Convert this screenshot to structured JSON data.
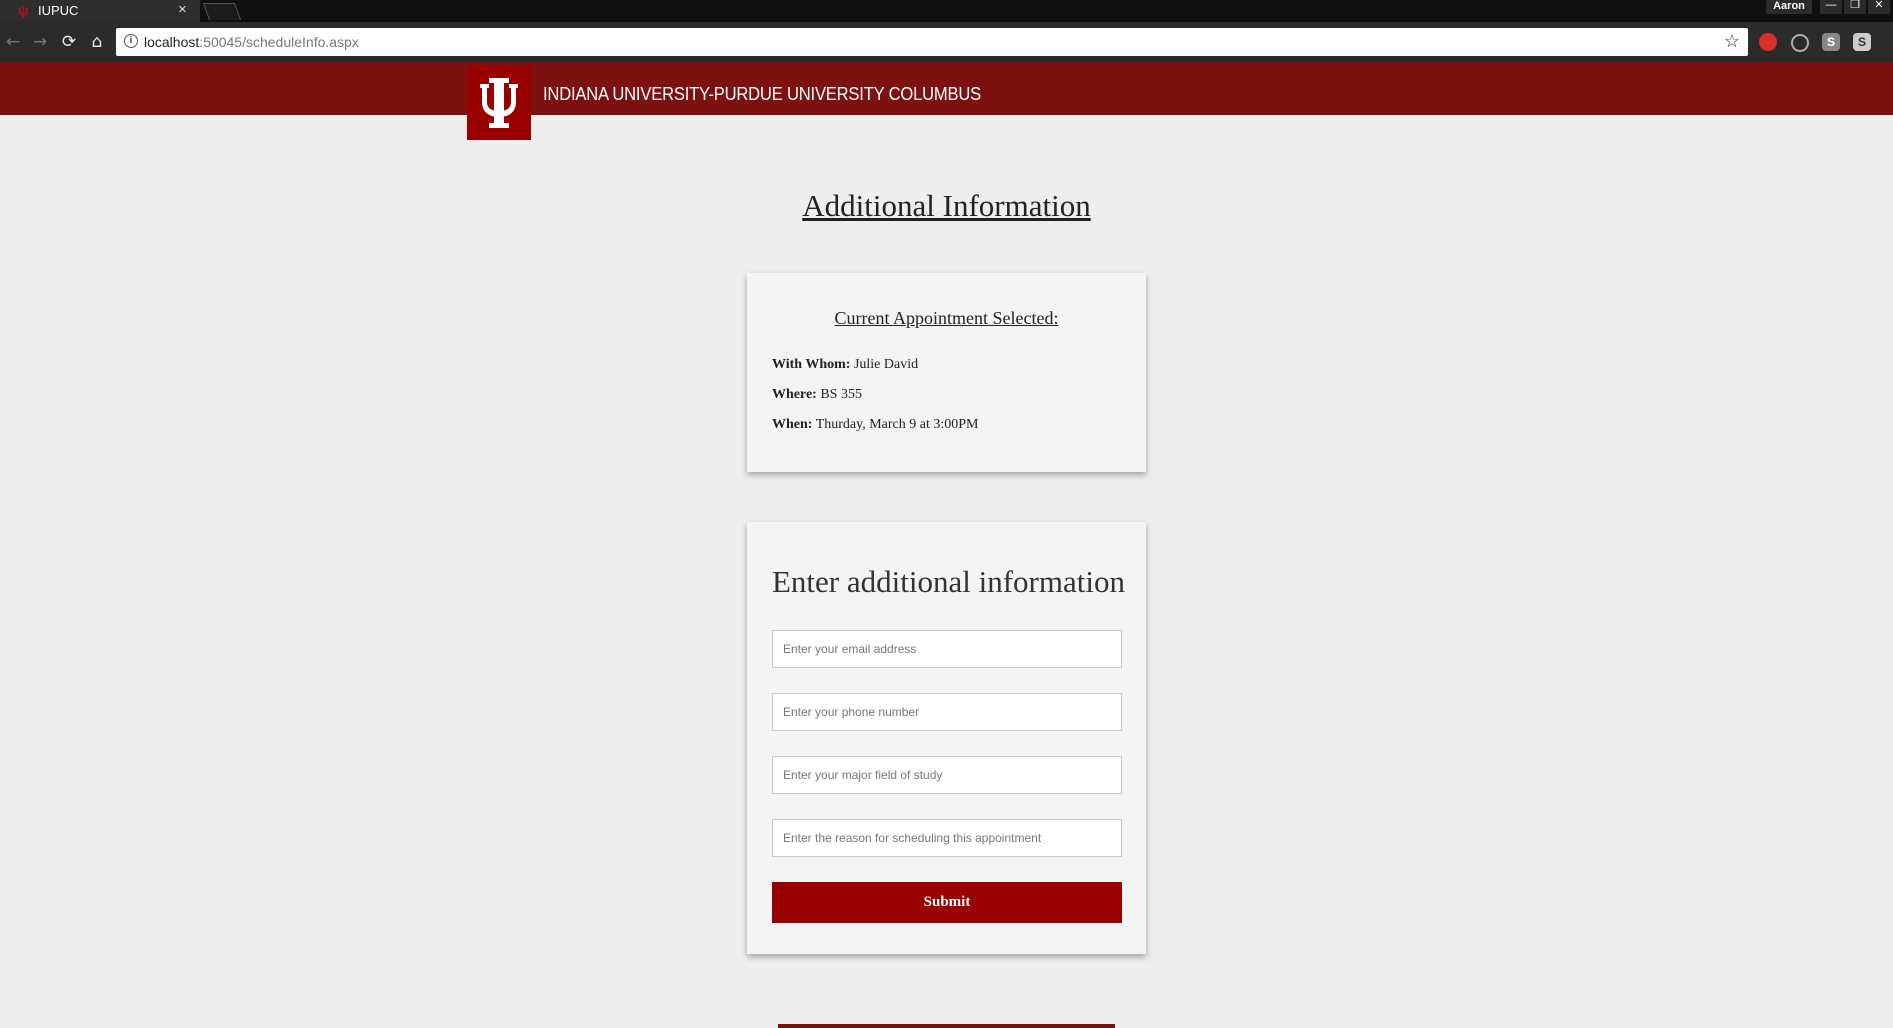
{
  "browser": {
    "tab_title": "IUPUC",
    "tab_close": "×",
    "profile_name": "Aaron",
    "url_host": "localhost",
    "url_rest": ":50045/scheduleInfo.aspx",
    "icons": [
      "back-icon",
      "forward-icon",
      "reload-icon",
      "home-icon",
      "info-icon",
      "star-icon"
    ],
    "window_controls": [
      "—",
      "❐",
      "✕"
    ]
  },
  "header": {
    "logo_glyph": "ψ",
    "university_name": "INDIANA UNIVERSITY-PURDUE UNIVERSITY COLUMBUS",
    "brand_color": "#7d110f"
  },
  "page": {
    "title": "Additional Information"
  },
  "appointment": {
    "heading": "Current Appointment Selected:",
    "with_whom_label": "With Whom:",
    "with_whom_value": "Julie David",
    "where_label": "Where:",
    "where_value": "BS 355",
    "when_label": "When:",
    "when_value": "Thurday, March 9 at 3:00PM"
  },
  "form": {
    "heading": "Enter additional information",
    "email_placeholder": "Enter your email address",
    "phone_placeholder": "Enter your phone number",
    "major_placeholder": "Enter your major field of study",
    "reason_placeholder": "Enter the reason for scheduling this appointment",
    "submit_label": "Submit",
    "accent_color": "#990000"
  }
}
